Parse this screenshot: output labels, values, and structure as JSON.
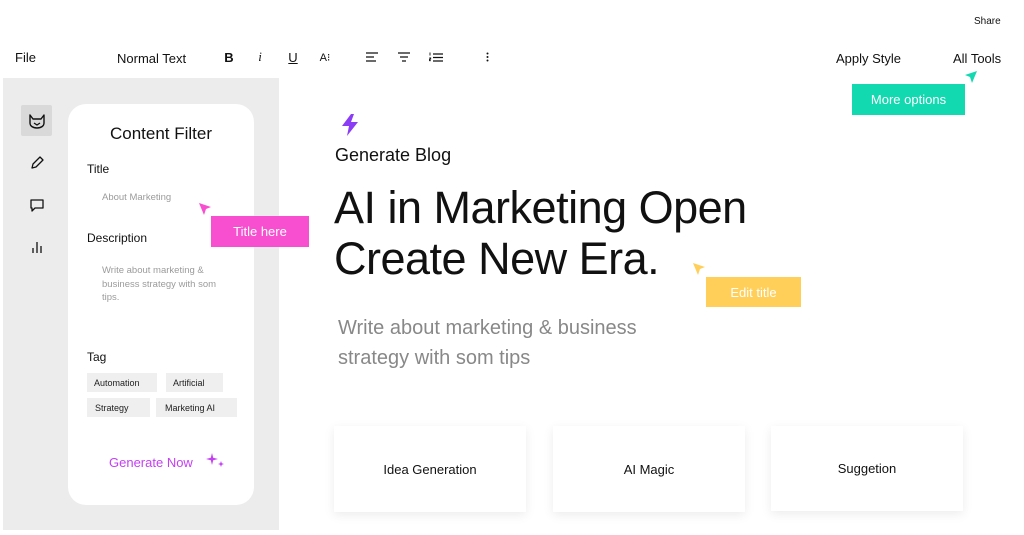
{
  "topbar": {
    "share": "Share",
    "file": "File",
    "text_style": "Normal Text",
    "bold": "B",
    "italic": "i",
    "underline": "U",
    "text_size": "A⁝",
    "apply_style": "Apply Style",
    "all_tools": "All Tools"
  },
  "sidebar": {
    "rail": [
      {
        "icon": "cat-logo-icon",
        "active": true
      },
      {
        "icon": "pencil-icon",
        "active": false
      },
      {
        "icon": "chat-bubble-icon",
        "active": false
      },
      {
        "icon": "bar-chart-icon",
        "active": false
      }
    ],
    "card": {
      "title": "Content Filter",
      "title_label": "Title",
      "title_placeholder": "About Marketing",
      "description_label": "Description",
      "description_placeholder": "Write about marketing & business strategy with som tips.",
      "tag_label": "Tag",
      "tags": [
        "Automation",
        "Artificial",
        "Strategy",
        "Marketing AI"
      ],
      "generate_button": "Generate Now"
    }
  },
  "callouts": {
    "title_here": "Title here",
    "edit_title": "Edit title",
    "more_options": "More options"
  },
  "main": {
    "section_label": "Generate Blog",
    "headline_line1": "AI in Marketing Open",
    "headline_line2": "Create New Era.",
    "subtext": "Write about marketing & business strategy with som tips",
    "features": [
      "Idea Generation",
      "AI Magic",
      "Suggetion"
    ]
  },
  "colors": {
    "accent_purple": "#8b3df5",
    "generate_pink": "#c43ff3",
    "callout_pink": "#f74fd0",
    "callout_yellow": "#ffcf5a",
    "callout_teal": "#13d9b0"
  }
}
